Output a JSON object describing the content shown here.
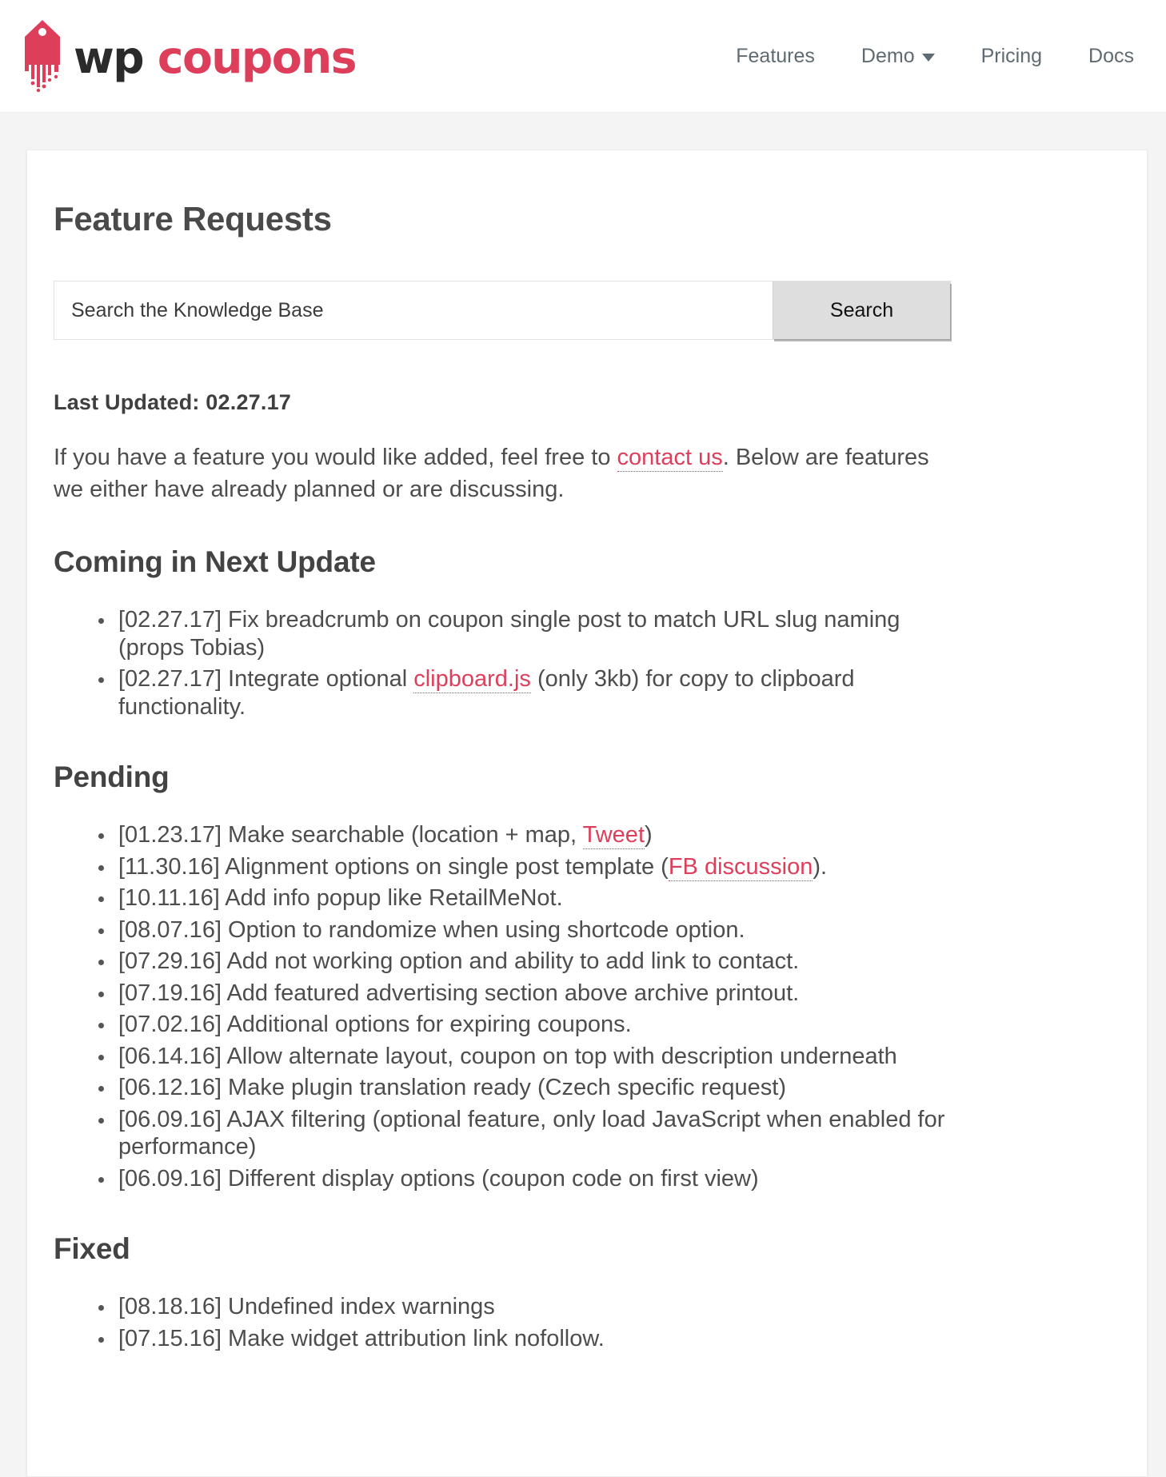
{
  "brand": {
    "word_first": "wp",
    "word_second": "coupons",
    "logo_color": "#dd3f5b",
    "text_color": "#2b2b2b"
  },
  "nav": {
    "items": [
      {
        "label": "Features",
        "has_dropdown": false
      },
      {
        "label": "Demo",
        "has_dropdown": true
      },
      {
        "label": "Pricing",
        "has_dropdown": false
      },
      {
        "label": "Docs",
        "has_dropdown": false
      }
    ]
  },
  "page": {
    "title": "Feature Requests",
    "last_updated": "Last Updated: 02.27.17"
  },
  "search": {
    "placeholder": "Search the Knowledge Base",
    "value": "",
    "button_label": "Search"
  },
  "intro": {
    "part1": "If you have a feature you would like added, feel free to ",
    "link": "contact us",
    "part2": ". Below are features we either have already planned or are discussing."
  },
  "sections": [
    {
      "heading": "Coming in Next Update",
      "items": [
        {
          "text_before": "[02.27.17] Fix breadcrumb on coupon single post to match URL slug naming (props Tobias)",
          "link": "",
          "text_after": ""
        },
        {
          "text_before": "[02.27.17] Integrate optional ",
          "link": "clipboard.js",
          "text_after": " (only 3kb) for copy to clipboard functionality."
        }
      ]
    },
    {
      "heading": "Pending",
      "items": [
        {
          "text_before": "[01.23.17] Make searchable (location + map, ",
          "link": "Tweet",
          "text_after": ")"
        },
        {
          "text_before": "[11.30.16] Alignment options on single post template (",
          "link": "FB discussion",
          "text_after": ")."
        },
        {
          "text_before": "[10.11.16] Add info popup like RetailMeNot.",
          "link": "",
          "text_after": ""
        },
        {
          "text_before": "[08.07.16] Option to randomize when using shortcode option.",
          "link": "",
          "text_after": ""
        },
        {
          "text_before": "[07.29.16] Add not working option and ability to add link to contact.",
          "link": "",
          "text_after": ""
        },
        {
          "text_before": "[07.19.16] Add featured advertising section above archive printout.",
          "link": "",
          "text_after": ""
        },
        {
          "text_before": "[07.02.16] Additional options for expiring coupons.",
          "link": "",
          "text_after": ""
        },
        {
          "text_before": "[06.14.16] Allow alternate layout, coupon on top with description underneath",
          "link": "",
          "text_after": ""
        },
        {
          "text_before": "[06.12.16] Make plugin translation ready (Czech specific request)",
          "link": "",
          "text_after": ""
        },
        {
          "text_before": "[06.09.16] AJAX filtering (optional feature, only load JavaScript when enabled for performance)",
          "link": "",
          "text_after": ""
        },
        {
          "text_before": "[06.09.16] Different display options (coupon code on first view)",
          "link": "",
          "text_after": ""
        }
      ]
    },
    {
      "heading": "Fixed",
      "items": [
        {
          "text_before": "[08.18.16] Undefined index warnings",
          "link": "",
          "text_after": ""
        },
        {
          "text_before": "[07.15.16] Make widget attribution link nofollow.",
          "link": "",
          "text_after": ""
        }
      ]
    }
  ]
}
